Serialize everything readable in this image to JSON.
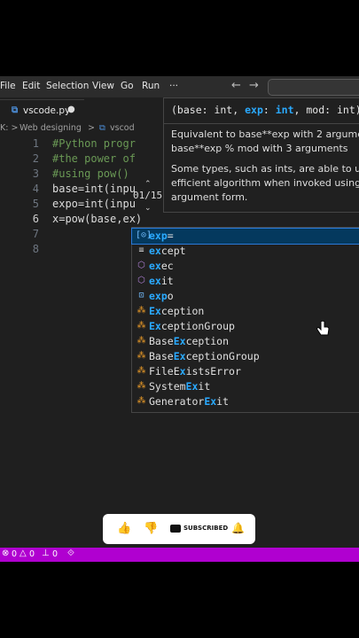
{
  "menu": {
    "items": [
      "File",
      "Edit",
      "Selection",
      "View",
      "Go",
      "Run",
      "···"
    ]
  },
  "tabs": {
    "active_file": "vscode.py",
    "second_file": "vscod"
  },
  "breadcrumb": {
    "prefix": "K: >",
    "folder": "Web designing",
    "sep": ">"
  },
  "code": {
    "line_numbers": [
      "1",
      "2",
      "3",
      "4",
      "5",
      "6",
      "7",
      "8"
    ],
    "lines": [
      "#Python progr",
      "#the power of",
      "#using pow()",
      "base=int(inpu",
      "expo=int(inpu",
      "x=pow(base,ex)"
    ]
  },
  "hover": {
    "signature": "(base: int, exp: int, mod: int)",
    "line1": "Equivalent to base**exp with 2 argume",
    "line2": "base**exp % mod with 3 arguments",
    "line3": "Some types, such as ints, are able to u",
    "line4": "efficient algorithm when invoked using",
    "line5": "argument form.",
    "counter": "01/15"
  },
  "suggestions": [
    {
      "pre": "",
      "match": "exp",
      "post": "=",
      "icon": "field"
    },
    {
      "pre": "",
      "match": "ex",
      "post": "cept",
      "icon": "keyword"
    },
    {
      "pre": "",
      "match": "ex",
      "post": "ec",
      "icon": "function"
    },
    {
      "pre": "",
      "match": "ex",
      "post": "it",
      "icon": "function"
    },
    {
      "pre": "",
      "match": "exp",
      "post": "o",
      "icon": "variable"
    },
    {
      "pre": "",
      "match": "Ex",
      "post": "ception",
      "icon": "class"
    },
    {
      "pre": "",
      "match": "Ex",
      "post": "ceptionGroup",
      "icon": "class"
    },
    {
      "pre": "Base",
      "match": "Ex",
      "post": "ception",
      "icon": "class"
    },
    {
      "pre": "Base",
      "match": "Ex",
      "post": "ceptionGroup",
      "icon": "class"
    },
    {
      "pre": "FileE",
      "match": "x",
      "post": "istsError",
      "icon": "class"
    },
    {
      "pre": "System",
      "match": "Ex",
      "post": "it",
      "icon": "class"
    },
    {
      "pre": "Generator",
      "match": "Ex",
      "post": "it",
      "icon": "class"
    }
  ],
  "status": {
    "errors": "0",
    "warnings": "0",
    "ports": "0"
  },
  "overlay": {
    "subscribe_label": "SUBSCRIBED"
  },
  "colors": {
    "accent": "#2aaaff",
    "statusbar": "#b000d0",
    "selection": "#04395e"
  }
}
